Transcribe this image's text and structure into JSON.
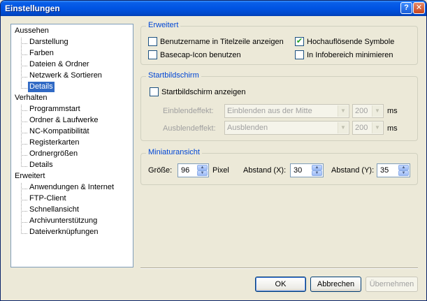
{
  "window": {
    "title": "Einstellungen",
    "help_label": "?",
    "close_label": "✕"
  },
  "tree": {
    "root_aussehen": "Aussehen",
    "aussehen_items": [
      "Darstellung",
      "Farben",
      "Dateien & Ordner",
      "Netzwerk & Sortieren",
      "Details"
    ],
    "root_verhalten": "Verhalten",
    "verhalten_items": [
      "Programmstart",
      "Ordner & Laufwerke",
      "NC-Kompatibilität",
      "Registerkarten",
      "Ordnergrößen",
      "Details"
    ],
    "root_erweitert": "Erweitert",
    "erweitert_items": [
      "Anwendungen & Internet",
      "FTP-Client",
      "Schnellansicht",
      "Archivunterstützung",
      "Dateiverknüpfungen"
    ],
    "selected": "Aussehen / Details"
  },
  "erweitert": {
    "legend": "Erweitert",
    "benutzername": {
      "label": "Benutzername in Titelzeile anzeigen",
      "checked": false
    },
    "hochaufloesend": {
      "label": "Hochauflösende Symbole",
      "checked": true
    },
    "basecap": {
      "label": "Basecap-Icon benutzen",
      "checked": false
    },
    "infobereich": {
      "label": "In Infobereich minimieren",
      "checked": false
    }
  },
  "startbildschirm": {
    "legend": "Startbildschirm",
    "anzeigen": {
      "label": "Startbildschirm anzeigen",
      "checked": false
    },
    "einblend_label": "Einblendeffekt:",
    "einblend_value": "Einblenden aus der Mitte",
    "einblend_ms": "200",
    "ausblend_label": "Ausblendeffekt:",
    "ausblend_value": "Ausblenden",
    "ausblend_ms": "200",
    "unit": "ms"
  },
  "miniaturansicht": {
    "legend": "Miniaturansicht",
    "groesse_label": "Größe:",
    "groesse_value": "96",
    "pixel_label": "Pixel",
    "abstand_x_label": "Abstand (X):",
    "abstand_x_value": "30",
    "abstand_y_label": "Abstand (Y):",
    "abstand_y_value": "35"
  },
  "buttons": {
    "ok": "OK",
    "abbrechen": "Abbrechen",
    "uebernehmen": "Übernehmen"
  },
  "icons": {
    "check": "✔",
    "up": "▲",
    "down": "▼"
  },
  "colors": {
    "accent": "#0046d5",
    "selection": "#316ac5",
    "check": "#21a121"
  }
}
